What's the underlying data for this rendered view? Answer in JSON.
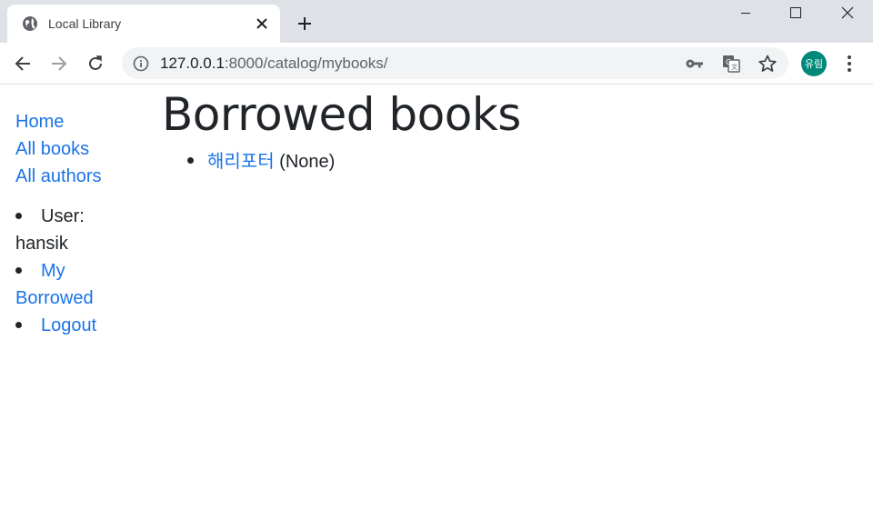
{
  "browser": {
    "tab_title": "Local Library",
    "url_host": "127.0.0.1",
    "url_path": ":8000/catalog/mybooks/",
    "profile_label": "유림",
    "profile_color": "#00897b"
  },
  "sidebar": {
    "links": {
      "home": "Home",
      "all_books": "All books",
      "all_authors": "All authors"
    },
    "user_label": "User:",
    "username": "hansik",
    "my_borrowed_1": "My",
    "my_borrowed_2": "Borrowed",
    "logout": "Logout"
  },
  "main": {
    "heading": "Borrowed books",
    "books": [
      {
        "title": "해리포터",
        "due": "(None)"
      }
    ]
  },
  "colors": {
    "link": "#1a73e8",
    "text": "#212529",
    "chrome": "#dee1e6"
  },
  "icons": {
    "favicon": "globe-icon",
    "info": "info-icon",
    "key": "key-icon",
    "translate": "translate-icon",
    "star": "star-icon",
    "menu": "kebab-menu-icon"
  }
}
